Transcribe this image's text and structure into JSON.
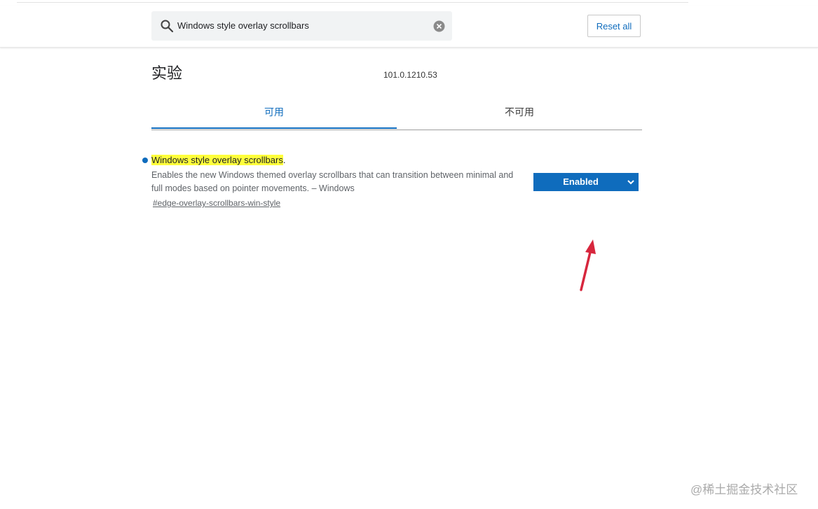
{
  "search": {
    "value": "Windows style overlay scrollbars"
  },
  "header": {
    "reset_label": "Reset all"
  },
  "page": {
    "title": "实验",
    "version": "101.0.1210.53"
  },
  "tabs": [
    {
      "label": "可用",
      "active": true
    },
    {
      "label": "不可用",
      "active": false
    }
  ],
  "flag": {
    "title_highlight": "Windows style overlay scrollbars",
    "title_suffix": ".",
    "description": "Enables the new Windows themed overlay scrollbars that can transition between minimal and full modes based on pointer movements. – Windows",
    "link": "#edge-overlay-scrollbars-win-style",
    "selected": "Enabled"
  },
  "watermark": "@稀土掘金技术社区",
  "colors": {
    "accent": "#0f6cbd",
    "highlight": "#ffff3b",
    "annotation_arrow": "#d7263d"
  },
  "icons": {
    "search": "search-icon",
    "clear": "clear-icon",
    "dropdown": "chevron-down-icon",
    "annotation": "arrow-annotation"
  }
}
